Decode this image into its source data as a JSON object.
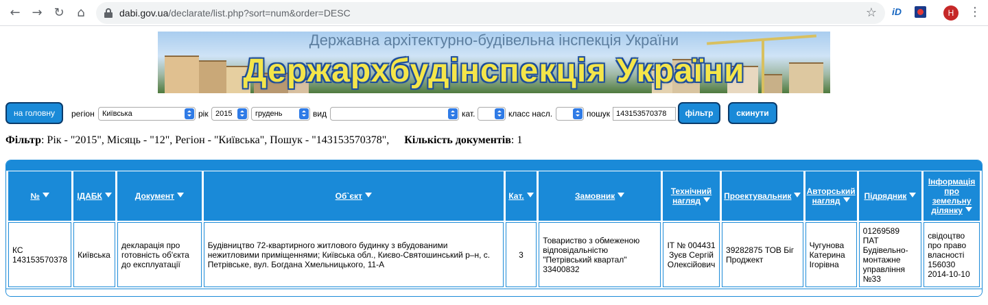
{
  "browser": {
    "url_host": "dabi.gov.ua",
    "url_path": "/declarate/list.php?sort=num&order=DESC",
    "avatar_letter": "H",
    "extension_1": "iD"
  },
  "banner": {
    "subtitle": "Державна архітектурно-будівельна інспекція України",
    "title": "Держархбудінспекція України"
  },
  "toolbar": {
    "home_label": "на головну",
    "region_label": "регіон",
    "region_value": "Київська",
    "year_label": "рік",
    "year_value": "2015",
    "month_value": "грудень",
    "type_label": "вид",
    "type_value": "",
    "category_label": "кат.",
    "category_value": "",
    "class_label": "класс насл.",
    "class_value": "",
    "search_label": "пошук",
    "search_value": "143153570378",
    "filter_label": "фільтр",
    "reset_label": "скинути"
  },
  "summary": {
    "filter_label": "Фільтр",
    "filter_text": ": Рік - \"2015\", Місяць - \"12\", Регіон - \"Київська\", Пошук - \"143153570378\",",
    "count_label": "Кількість документів",
    "count_value": ": 1"
  },
  "table": {
    "headers": [
      "№",
      "ІДАБК",
      "Документ",
      "Об`єкт",
      "Кат.",
      "Замовник",
      "Технічний нагляд",
      "Проектувальник",
      "Авторський нагляд",
      "Підрядник",
      "Інформація про земельну ділянку"
    ],
    "rows": [
      [
        "КС 143153570378",
        "Київська",
        "декларація про готовність об'єкта до експлуатації",
        "Будівництво 72-квартирного житлового будинку з вбудованими нежитловими приміщеннями; Київська обл., Києво-Святошинський р–н, с. Петрівське, вул. Богдана Хмельницького, 11-А",
        "3",
        "Товариство з обмеженою відповідальністю \"Петрівський квартал\" 33400832",
        "ІТ № 004431 Зуєв Сергій Олексійович",
        "39282875 ТОВ Біг Проджект",
        "Чугунова Катерина Ігорівна",
        "01269589 ПАТ Будівельно-монтажне управління №33",
        "свідоцтво про право власності 156030 2014-10-10"
      ]
    ]
  }
}
